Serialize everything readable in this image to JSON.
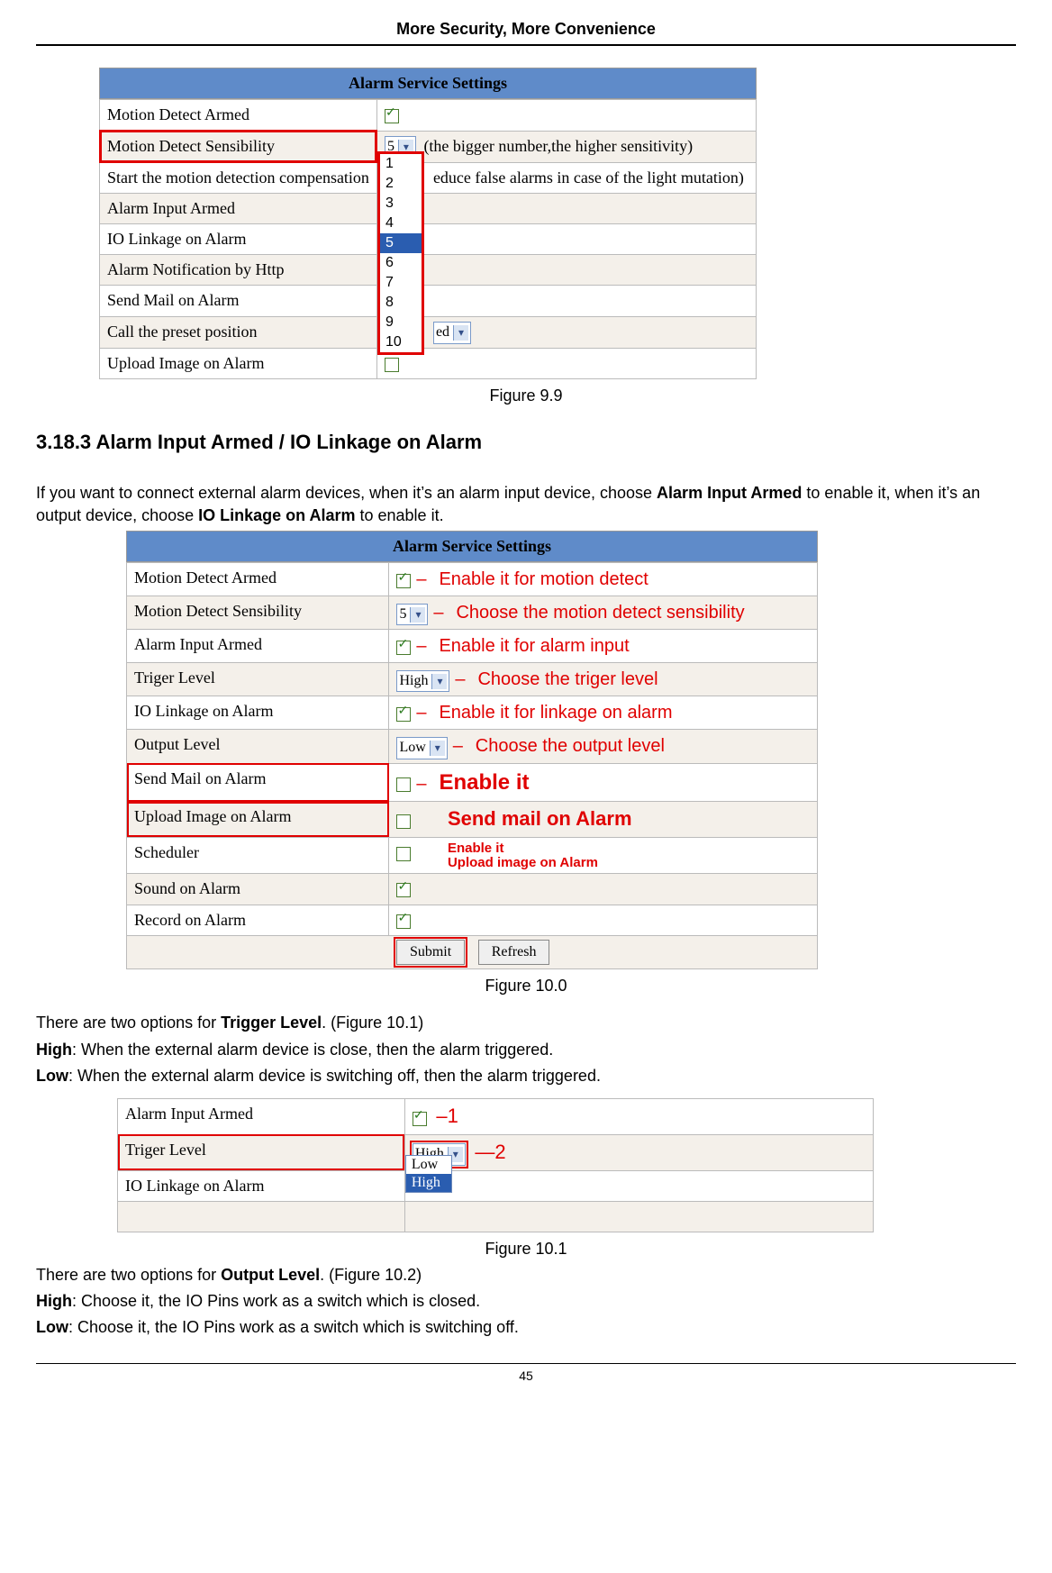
{
  "header": "More Security, More Convenience",
  "page_number": "45",
  "fig99": {
    "title": "Alarm Service Settings",
    "caption": "Figure 9.9",
    "rows": {
      "motion_detect_armed": "Motion Detect Armed",
      "motion_detect_sensibility": "Motion Detect Sensibility",
      "start_compensation": "Start the motion detection compensation",
      "alarm_input_armed": "Alarm Input Armed",
      "io_linkage": "IO Linkage on Alarm",
      "alarm_notification_http": "Alarm Notification by Http",
      "send_mail": "Send Mail on Alarm",
      "call_preset": "Call the preset position",
      "upload_image": "Upload Image on Alarm"
    },
    "sens_value": "5",
    "sens_hint": "(the bigger number,the higher sensitivity)",
    "compensation_hint_right": "educe false alarms in case of the light mutation)",
    "dropdown_options": [
      "1",
      "2",
      "3",
      "4",
      "5",
      "6",
      "7",
      "8",
      "9",
      "10"
    ],
    "dropdown_selected": "5",
    "preset_partial": "ed"
  },
  "section_heading": "3.18.3 Alarm Input Armed / IO Linkage on Alarm",
  "section_p1a": "If you want to connect external alarm devices, when it’s an alarm input device, choose ",
  "section_p1b": "Alarm Input Armed",
  "section_p1c": " to enable it, when it’s an output device, choose ",
  "section_p1d": "IO Linkage on Alarm",
  "section_p1e": " to enable it.",
  "fig100": {
    "title": "Alarm Service Settings",
    "caption": "Figure 10.0",
    "rows": {
      "motion_detect_armed": "Motion Detect Armed",
      "motion_detect_sensibility": "Motion Detect Sensibility",
      "alarm_input_armed": "Alarm Input Armed",
      "triger_level": "Triger Level",
      "io_linkage": "IO Linkage on Alarm",
      "output_level": "Output Level",
      "send_mail": "Send Mail on Alarm",
      "upload_image": "Upload Image on Alarm",
      "scheduler": "Scheduler",
      "sound_on_alarm": "Sound on Alarm",
      "record_on_alarm": "Record on Alarm"
    },
    "sens_value": "5",
    "triger_value": "High",
    "output_value": "Low",
    "submit": "Submit",
    "refresh": "Refresh",
    "ann": {
      "motion_enable": "Enable it for motion detect",
      "choose_sens": "Choose the motion detect sensibility",
      "alarm_input_enable": "Enable it for alarm input",
      "choose_triger": "Choose the triger level",
      "linkage_enable": "Enable it for linkage on alarm",
      "choose_output": "Choose the output level",
      "enable_it_big": "Enable it",
      "send_mail_big": "Send mail on Alarm",
      "enable_it_small": "Enable it",
      "upload_small": "Upload image on Alarm"
    }
  },
  "trig_p1a": "There are two options for ",
  "trig_p1b": "Trigger Level",
  "trig_p1c": ". (Figure 10.1)",
  "trig_high_label": "High",
  "trig_high_text": ": When the external alarm device is close, then the alarm triggered.",
  "trig_low_label": "Low",
  "trig_low_text": ": When the external alarm device is switching off, then the alarm triggered.",
  "fig101": {
    "caption": "Figure 10.1",
    "rows": {
      "alarm_input_armed": "Alarm Input Armed",
      "triger_level": "Triger Level",
      "io_linkage": "IO Linkage on Alarm"
    },
    "triger_value": "High",
    "dd_options": [
      "Low",
      "High"
    ],
    "dd_selected": "High",
    "num1": "1",
    "num2": "2"
  },
  "out_p1a": "There are two options for ",
  "out_p1b": "Output Level",
  "out_p1c": ". (Figure 10.2)",
  "out_high_label": "High",
  "out_high_text": ": Choose it, the IO Pins work as a switch which is closed.",
  "out_low_label": "Low",
  "out_low_text": ": Choose it, the IO Pins work as a switch which is switching off."
}
